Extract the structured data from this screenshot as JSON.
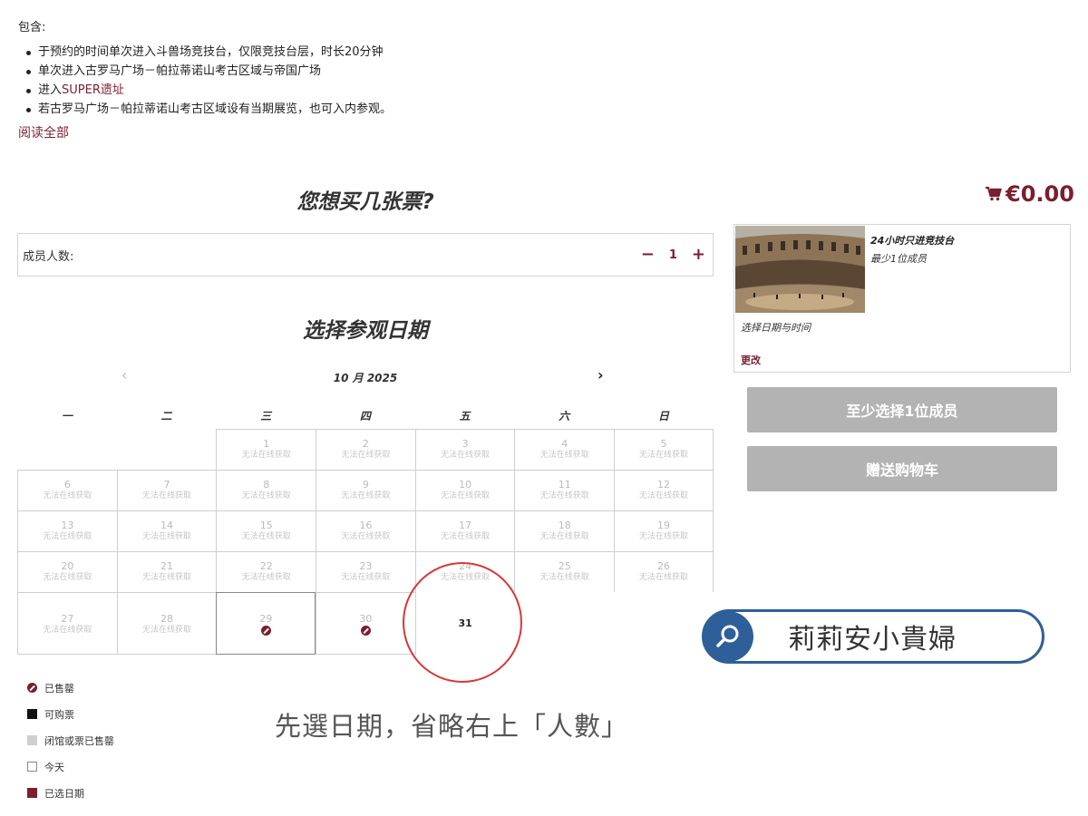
{
  "includes": {
    "heading": "包含:",
    "items": [
      "于预约的时间单次进入斗兽场竞技台，仅限竞技台层，时长20分钟",
      "单次进入古罗马广场－帕拉蒂诺山考古区域与帝国广场",
      "进入",
      "若古罗马广场－帕拉蒂诺山考古区域设有当期展览，也可入内参观。"
    ],
    "super_link": "SUPER遗址",
    "read_all": "阅读全部"
  },
  "tickets_heading": "您想买几张票?",
  "members": {
    "label": "成员人数:",
    "minus": "−",
    "value": "1",
    "plus": "+"
  },
  "date_heading": "选择参观日期",
  "calendar": {
    "prev": "‹",
    "month": "10 月 2025",
    "next": "›",
    "weekdays": [
      "一",
      "二",
      "三",
      "四",
      "五",
      "六",
      "日"
    ],
    "unavailable_text": "无法在线获取",
    "days": [
      "1",
      "2",
      "3",
      "4",
      "5",
      "6",
      "7",
      "8",
      "9",
      "10",
      "11",
      "12",
      "13",
      "14",
      "15",
      "16",
      "17",
      "18",
      "19",
      "20",
      "21",
      "22",
      "23",
      "24",
      "25",
      "26",
      "27",
      "28",
      "29",
      "30",
      "31"
    ]
  },
  "legend": [
    "已售罄",
    "可购票",
    "闭馆或票已售罄",
    "今天",
    "已选日期"
  ],
  "annotation": "先選日期，省略右上「人數」",
  "cart": {
    "total": "€0.00"
  },
  "summary": {
    "title": "24小时只进竞技台",
    "min": "最少1位成员",
    "choose": "选择日期与时间",
    "change": "更改"
  },
  "buttons": {
    "select_member": "至少选择1位成员",
    "gift_cart": "赠送购物车"
  },
  "watermark": {
    "text": "莉莉安小貴婦",
    "icon": "search-icon"
  },
  "colors": {
    "accent": "#7a1f30",
    "button_grey": "#b3b3b3",
    "pill_blue": "#2f5f99",
    "circle_red": "#d8373a"
  }
}
